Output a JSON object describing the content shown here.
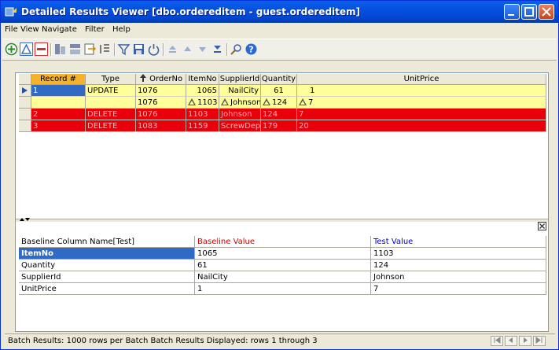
{
  "window": {
    "title": "Detailed Results Viewer [dbo.ordereditem - guest.ordereditem]"
  },
  "menu": [
    "File",
    "View",
    "Navigate",
    "Filter",
    "Help"
  ],
  "grid": {
    "headers": [
      "Record #",
      "Type",
      "OrderNo",
      "ItemNo",
      "SupplierId",
      "Quantity",
      "UnitPrice"
    ],
    "rows": [
      {
        "record": "1",
        "type": "UPDATE",
        "orderno": "1076",
        "itemno": "1065",
        "supplierid": "NailCity",
        "quantity": "61",
        "unitprice": "1",
        "style": "yellow"
      },
      {
        "record": "",
        "type": "",
        "orderno": "1076",
        "itemno": "1103",
        "supplierid": "Johnson",
        "quantity": "124",
        "unitprice": "7",
        "style": "yellow-diff"
      },
      {
        "record": "2",
        "type": "DELETE",
        "orderno": "1076",
        "itemno": "1103",
        "supplierid": "Johnson",
        "quantity": "124",
        "unitprice": "7",
        "style": "red"
      },
      {
        "record": "3",
        "type": "DELETE",
        "orderno": "1083",
        "itemno": "1159",
        "supplierid": "ScrewDepot",
        "quantity": "179",
        "unitprice": "20",
        "style": "red"
      }
    ]
  },
  "detail": {
    "headers": [
      "Baseline Column Name[Test]",
      "Baseline Value",
      "Test Value"
    ],
    "header_colors": [
      "#000000",
      "#CC0000",
      "#0000CC"
    ],
    "rows": [
      {
        "name": "ItemNo",
        "baseline": "1065",
        "test": "1103"
      },
      {
        "name": "Quantity",
        "baseline": "61",
        "test": "124"
      },
      {
        "name": "SupplierId",
        "baseline": "NailCity",
        "test": "Johnson"
      },
      {
        "name": "UnitPrice",
        "baseline": "1",
        "test": "7"
      }
    ]
  },
  "status": {
    "text": "Batch Results: 1000 rows per Batch    Batch Results Displayed: rows 1 through 3"
  }
}
